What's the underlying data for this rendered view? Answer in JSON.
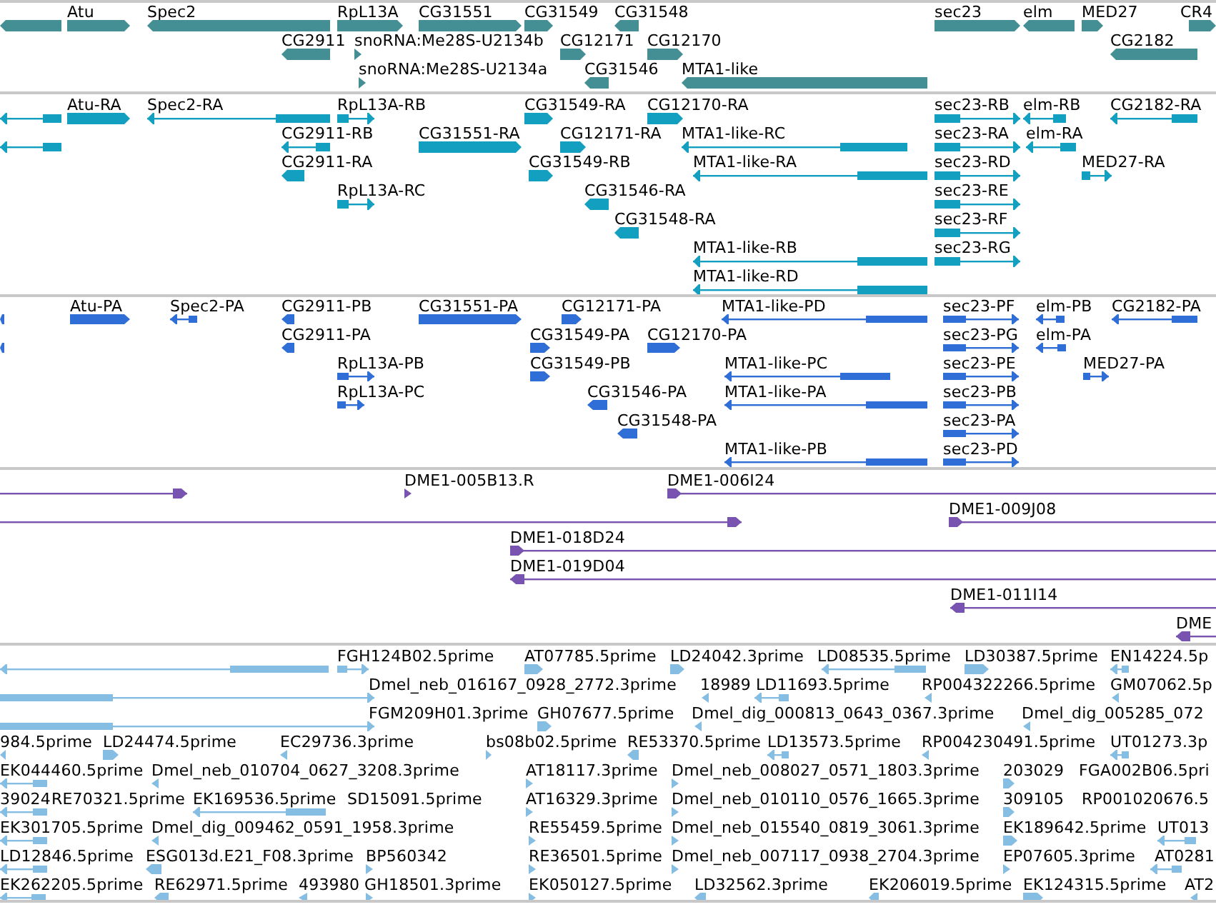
{
  "tracks": [
    {
      "kind": "gene",
      "rows": [
        {
          "features": [
            {
              "reverse": true
            },
            {
              "label": "Atu",
              "reverse": false
            },
            {
              "label": "Spec2",
              "reverse": true
            },
            {
              "label": "RpL13A",
              "reverse": false
            },
            {
              "label": "CG31551",
              "reverse": false
            },
            {
              "label": "CG31549",
              "reverse": false
            },
            {
              "label": "CG31548",
              "reverse": true
            },
            {
              "label": "sec23",
              "reverse": false
            },
            {
              "label": "elm",
              "reverse": true
            },
            {
              "label": "MED27",
              "reverse": false
            },
            {
              "label": "CR4",
              "reverse": false
            }
          ]
        },
        {
          "features": [
            {
              "label": "CG2911",
              "reverse": true
            },
            {
              "label": "snoRNA:Me28S-U2134b",
              "reverse": false
            },
            {
              "label": "CG12171",
              "reverse": false
            },
            {
              "label": "CG12170",
              "reverse": false
            },
            {
              "label": "CG2182",
              "reverse": true
            }
          ]
        },
        {
          "features": [
            {
              "label": "snoRNA:Me28S-U2134a",
              "reverse": false
            },
            {
              "label": "CG31546",
              "reverse": true
            },
            {
              "label": "MTA1-like",
              "reverse": true
            }
          ]
        }
      ]
    },
    {
      "kind": "transcript",
      "rows": [
        {
          "features": [
            {
              "reverse": true
            },
            {
              "label": "Atu-RA",
              "reverse": false
            },
            {
              "label": "Spec2-RA",
              "reverse": true
            },
            {
              "label": "RpL13A-RB",
              "reverse": false
            },
            {
              "label": "CG31549-RA",
              "reverse": false
            },
            {
              "label": "CG12170-RA",
              "reverse": false
            },
            {
              "label": "sec23-RB",
              "reverse": false
            },
            {
              "label": "elm-RB",
              "reverse": true
            },
            {
              "label": "CG2182-RA",
              "reverse": true
            }
          ]
        },
        {
          "features": [
            {
              "reverse": true
            },
            {
              "label": "CG2911-RB",
              "reverse": true
            },
            {
              "label": "CG31551-RA",
              "reverse": false
            },
            {
              "label": "CG12171-RA",
              "reverse": false
            },
            {
              "label": "MTA1-like-RC",
              "reverse": true
            },
            {
              "label": "sec23-RA",
              "reverse": false
            },
            {
              "label": "elm-RA",
              "reverse": true
            }
          ]
        },
        {
          "features": [
            {
              "label": "CG2911-RA",
              "reverse": true
            },
            {
              "label": "CG31549-RB",
              "reverse": false
            },
            {
              "label": "MTA1-like-RA",
              "reverse": true
            },
            {
              "label": "sec23-RD",
              "reverse": false
            },
            {
              "label": "MED27-RA",
              "reverse": false
            }
          ]
        },
        {
          "features": [
            {
              "label": "RpL13A-RC",
              "reverse": false
            },
            {
              "label": "CG31546-RA",
              "reverse": true
            },
            {
              "label": "sec23-RE",
              "reverse": false
            }
          ]
        },
        {
          "features": [
            {
              "label": "CG31548-RA",
              "reverse": true
            },
            {
              "label": "sec23-RF",
              "reverse": false
            }
          ]
        },
        {
          "features": [
            {
              "label": "MTA1-like-RB",
              "reverse": true
            },
            {
              "label": "sec23-RG",
              "reverse": false
            }
          ]
        },
        {
          "features": [
            {
              "label": "MTA1-like-RD",
              "reverse": true
            }
          ]
        }
      ]
    },
    {
      "kind": "protein",
      "rows": [
        {
          "features": [
            {
              "reverse": true
            },
            {
              "label": "Atu-PA",
              "reverse": false
            },
            {
              "label": "Spec2-PA",
              "reverse": true
            },
            {
              "label": "CG2911-PB",
              "reverse": true
            },
            {
              "label": "CG31551-PA",
              "reverse": false
            },
            {
              "label": "CG12171-PA",
              "reverse": false
            },
            {
              "label": "MTA1-like-PD",
              "reverse": true
            },
            {
              "label": "sec23-PF",
              "reverse": false
            },
            {
              "label": "elm-PB",
              "reverse": true
            },
            {
              "label": "CG2182-PA",
              "reverse": true
            }
          ]
        },
        {
          "features": [
            {
              "reverse": true
            },
            {
              "label": "CG2911-PA",
              "reverse": true
            },
            {
              "label": "CG31549-PA",
              "reverse": false
            },
            {
              "label": "CG12170-PA",
              "reverse": false
            },
            {
              "label": "sec23-PG",
              "reverse": false
            },
            {
              "label": "elm-PA",
              "reverse": true
            }
          ]
        },
        {
          "features": [
            {
              "label": "RpL13A-PB",
              "reverse": false
            },
            {
              "label": "CG31549-PB",
              "reverse": false
            },
            {
              "label": "MTA1-like-PC",
              "reverse": true
            },
            {
              "label": "sec23-PE",
              "reverse": false
            },
            {
              "label": "MED27-PA",
              "reverse": false
            }
          ]
        },
        {
          "features": [
            {
              "label": "RpL13A-PC",
              "reverse": false
            },
            {
              "label": "CG31546-PA",
              "reverse": true
            },
            {
              "label": "MTA1-like-PA",
              "reverse": true
            },
            {
              "label": "sec23-PB",
              "reverse": false
            }
          ]
        },
        {
          "features": [
            {
              "label": "CG31548-PA",
              "reverse": true
            },
            {
              "label": "sec23-PA",
              "reverse": false
            }
          ]
        },
        {
          "features": [
            {
              "label": "MTA1-like-PB",
              "reverse": true
            },
            {
              "label": "sec23-PD",
              "reverse": false
            }
          ]
        }
      ]
    },
    {
      "kind": "clone",
      "rows": [
        {
          "features": [
            {
              "reverse": false
            },
            {
              "label": "DME1-005B13.R",
              "reverse": false
            },
            {
              "label": "DME1-006I24",
              "reverse": false
            }
          ]
        },
        {
          "features": [
            {
              "reverse": false
            },
            {
              "label": "DME1-009J08",
              "reverse": false
            }
          ]
        },
        {
          "features": [
            {
              "label": "DME1-018D24",
              "reverse": false
            }
          ]
        },
        {
          "features": [
            {
              "label": "DME1-019D04",
              "reverse": true
            }
          ]
        },
        {
          "features": [
            {
              "label": "DME1-011I14",
              "reverse": true
            }
          ]
        },
        {
          "features": [
            {
              "label": "DME",
              "reverse": true
            }
          ]
        }
      ]
    },
    {
      "kind": "est",
      "rows": [
        {
          "features": [
            {
              "reverse": true
            },
            {
              "label": "FGH124B02.5prime",
              "reverse": false
            },
            {
              "label": "AT07785.5prime",
              "reverse": false
            },
            {
              "label": "LD24042.3prime",
              "reverse": false
            },
            {
              "label": "LD08535.5prime",
              "reverse": true
            },
            {
              "label": "LD30387.5prime",
              "reverse": false
            },
            {
              "label": "EN14224.5p",
              "reverse": true
            }
          ]
        },
        {
          "features": [
            {
              "reverse": false
            },
            {
              "label": "Dmel_neb_016167_0928_2772.3prime"
            },
            {
              "label": "18989",
              "reverse": true
            },
            {
              "label": "LD11693.5prime",
              "reverse": true
            },
            {
              "label": "RP004322266.5prime",
              "reverse": true
            },
            {
              "label": "GM07062.5p",
              "reverse": true
            }
          ]
        },
        {
          "features": [
            {
              "reverse": false
            },
            {
              "label": "FGM209H01.3prime"
            },
            {
              "label": "GH07677.5prime",
              "reverse": false
            },
            {
              "label": "Dmel_dig_000813_0643_0367.3prime",
              "reverse": true
            },
            {
              "label": "Dmel_dig_005285_072",
              "reverse": true
            }
          ]
        },
        {
          "features": [
            {
              "label": "984.5prime",
              "reverse": true
            },
            {
              "label": "LD24474.5prime",
              "reverse": false
            },
            {
              "label": "EC29736.3prime",
              "reverse": true
            },
            {
              "label": "bs08b02.5prime",
              "reverse": false
            },
            {
              "label": "RE53370.5prime",
              "reverse": true
            },
            {
              "label": "LD13573.5prime",
              "reverse": true
            },
            {
              "label": "RP004230491.5prime",
              "reverse": true
            },
            {
              "label": "UT01273.3p",
              "reverse": true
            }
          ]
        },
        {
          "features": [
            {
              "label": "EK044460.5prime",
              "reverse": true
            },
            {
              "label": "Dmel_neb_010704_0627_3208.3prime",
              "reverse": true
            },
            {
              "label": "AT18117.3prime",
              "reverse": false
            },
            {
              "label": "Dmel_neb_008027_0571_1803.3prime",
              "reverse": false
            },
            {
              "label": "203029",
              "reverse": false
            },
            {
              "label": "FGA002B06.5pri"
            }
          ]
        },
        {
          "features": [
            {
              "label": "39024",
              "reverse": true
            },
            {
              "label": "RE70321.5prime"
            },
            {
              "label": "EK169536.5prime",
              "reverse": true
            },
            {
              "label": "SD15091.5prime"
            },
            {
              "label": "AT16329.3prime",
              "reverse": false
            },
            {
              "label": "Dmel_neb_010110_0576_1665.3prime",
              "reverse": false
            },
            {
              "label": "309105",
              "reverse": false
            },
            {
              "label": "RP001020676.5"
            }
          ]
        },
        {
          "features": [
            {
              "label": "EK301705.5prime",
              "reverse": true
            },
            {
              "label": "Dmel_dig_009462_0591_1958.3prime",
              "reverse": true
            },
            {
              "label": "RE55459.5prime",
              "reverse": false
            },
            {
              "label": "Dmel_neb_015540_0819_3061.3prime",
              "reverse": false
            },
            {
              "label": "EK189642.5prime",
              "reverse": false
            },
            {
              "label": "UT013",
              "reverse": true
            }
          ]
        },
        {
          "features": [
            {
              "label": "LD12846.5prime",
              "reverse": true
            },
            {
              "label": "ESG013d.E21_F08.3prime",
              "reverse": true
            },
            {
              "label": "BP560342",
              "reverse": false
            },
            {
              "label": "RE36501.5prime",
              "reverse": false
            },
            {
              "label": "Dmel_neb_007117_0938_2704.3prime",
              "reverse": false
            },
            {
              "label": "EP07605.3prime",
              "reverse": false
            },
            {
              "label": "AT0281",
              "reverse": true
            }
          ]
        },
        {
          "features": [
            {
              "label": "EK262205.5prime",
              "reverse": true
            },
            {
              "label": "RE62971.5prime",
              "reverse": true
            },
            {
              "label": "493980",
              "reverse": true
            },
            {
              "label": "GH18501.3prime",
              "reverse": false
            },
            {
              "label": "EK050127.5prime",
              "reverse": false
            },
            {
              "label": "LD32562.3prime",
              "reverse": true
            },
            {
              "label": "EK206019.5prime",
              "reverse": true
            },
            {
              "label": "EK124315.5prime",
              "reverse": false
            },
            {
              "label": "AT2",
              "reverse": true
            }
          ]
        }
      ]
    }
  ]
}
